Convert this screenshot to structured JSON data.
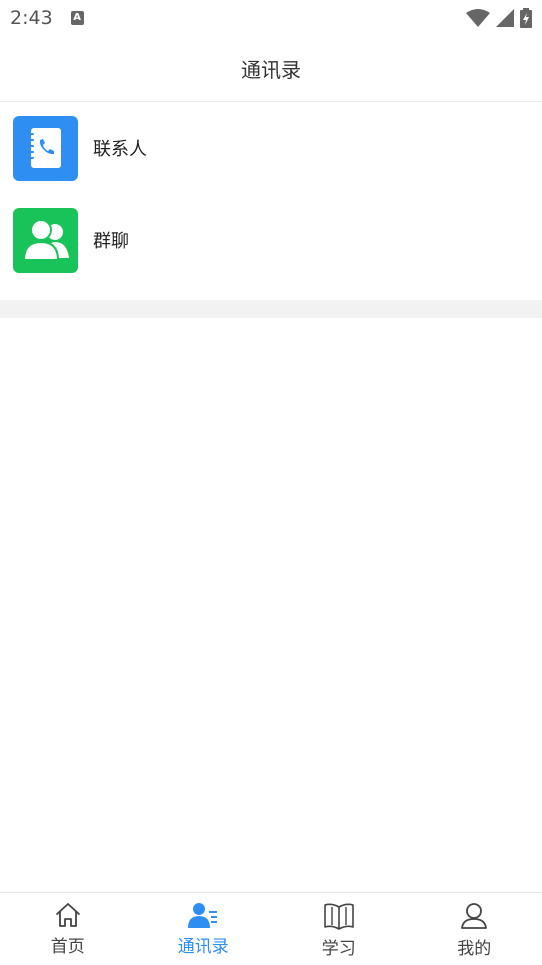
{
  "status_bar": {
    "time": "2:43",
    "app_icon_letter": "A",
    "icons": [
      "wifi-icon",
      "cell-signal-icon",
      "battery-charging-icon"
    ]
  },
  "header": {
    "title": "通讯录"
  },
  "list": {
    "items": [
      {
        "label": "联系人",
        "icon": "contacts-book-icon",
        "color": "#2f8ef2"
      },
      {
        "label": "群聊",
        "icon": "group-chat-icon",
        "color": "#18c35a"
      }
    ]
  },
  "tab_bar": {
    "active_color": "#2f8ef2",
    "tabs": [
      {
        "label": "首页",
        "icon": "home-icon",
        "active": false
      },
      {
        "label": "通讯录",
        "icon": "contacts-icon",
        "active": true
      },
      {
        "label": "学习",
        "icon": "book-icon",
        "active": false
      },
      {
        "label": "我的",
        "icon": "profile-icon",
        "active": false
      }
    ]
  }
}
